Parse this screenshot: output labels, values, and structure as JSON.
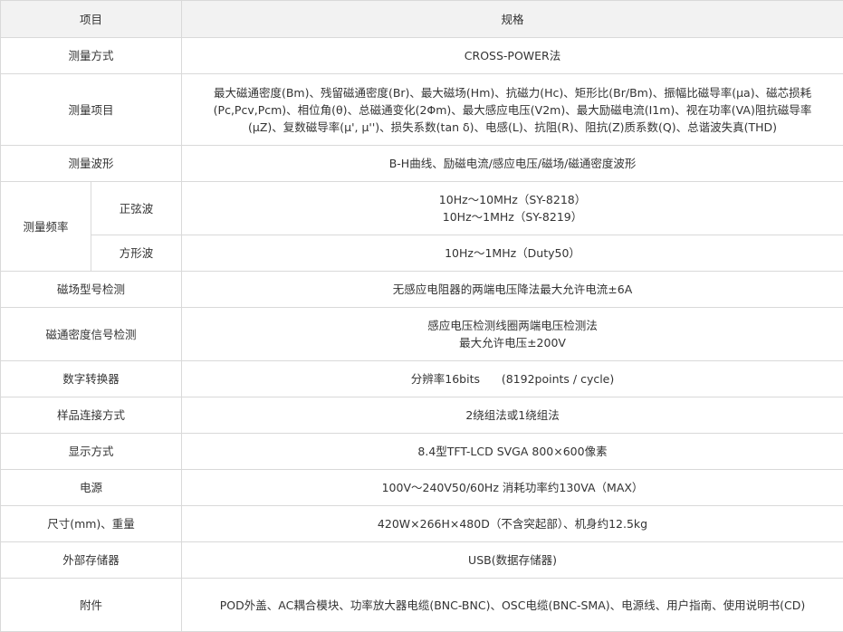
{
  "header": {
    "item": "项目",
    "spec": "规格"
  },
  "rows": {
    "method": {
      "label": "测量方式",
      "value": "CROSS-POWER法"
    },
    "items": {
      "label": "测量项目",
      "lines": [
        "最大磁通密度(Bm)、残留磁通密度(Br)、最大磁场(Hm)、抗磁力(Hc)、矩形比(Br/Bm)、振幅比磁导率(μa)、磁芯损耗",
        "(Pc,Pcv,Pcm)、相位角(θ)、总磁通变化(2Φm)、最大感应电压(V2m)、最大励磁电流(I1m)、视在功率(VA)阻抗磁导率",
        "(μZ)、复数磁导率(μ', μ'')、损失系数(tan δ)、电感(L)、抗阻(R)、阻抗(Z)质系数(Q)、总谐波失真(THD)"
      ]
    },
    "waveform": {
      "label": "测量波形",
      "value": "B-H曲线、励磁电流/感应电压/磁场/磁通密度波形"
    },
    "frequency": {
      "label": "测量频率",
      "sine": {
        "label": "正弦波",
        "lines": [
          "10Hz～10MHz（SY-8218）",
          "10Hz～1MHz（SY-8219）"
        ]
      },
      "square": {
        "label": "方形波",
        "value": "10Hz～1MHz（Duty50）"
      }
    },
    "field_detect": {
      "label": "磁场型号检测",
      "value": "无感应电阻器的两端电压降法最大允许电流±6A"
    },
    "flux_detect": {
      "label": "磁通密度信号检测",
      "lines": [
        "感应电压检测线圈两端电压检测法",
        "最大允许电压±200V"
      ]
    },
    "adc": {
      "label": "数字转换器",
      "value": "分辨率16bits      (8192points / cycle)"
    },
    "connection": {
      "label": "样品连接方式",
      "value": "2绕组法或1绕组法"
    },
    "display": {
      "label": "显示方式",
      "value": "8.4型TFT-LCD SVGA 800×600像素"
    },
    "power": {
      "label": "电源",
      "value": "100V～240V50/60Hz 消耗功率约130VA（MAX）"
    },
    "size": {
      "label": "尺寸(mm)、重量",
      "value": "420W×266H×480D（不含突起部）、机身约12.5kg"
    },
    "storage": {
      "label": "外部存储器",
      "value": "USB(数据存储器)"
    },
    "accessories": {
      "label": "附件",
      "value": "POD外盖、AC耦合模块、功率放大器电缆(BNC-BNC)、OSC电缆(BNC-SMA)、电源线、用户指南、使用说明书(CD)"
    }
  }
}
